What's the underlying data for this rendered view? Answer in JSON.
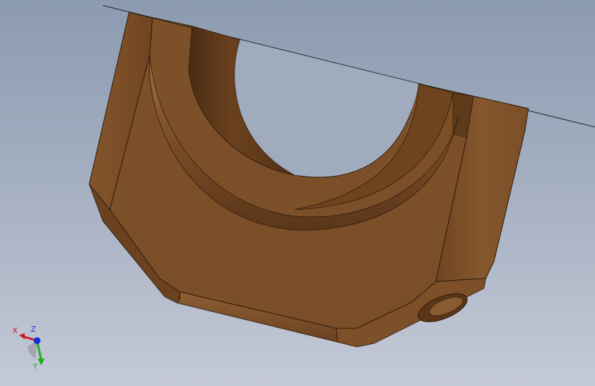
{
  "viewport": {
    "background_top": "#8c9bb0",
    "background_bottom": "#c4c9d6"
  },
  "part": {
    "body_color": "#7b4f28",
    "shadow_color": "#5e3a1b",
    "highlight_color": "#9a6a3c",
    "edge_color": "#2a1a0c"
  },
  "triad": {
    "x_label": "X",
    "y_label": "Y",
    "z_label": "Z",
    "x_color": "#d01818",
    "y_color": "#18b018",
    "z_color": "#1030d8"
  }
}
